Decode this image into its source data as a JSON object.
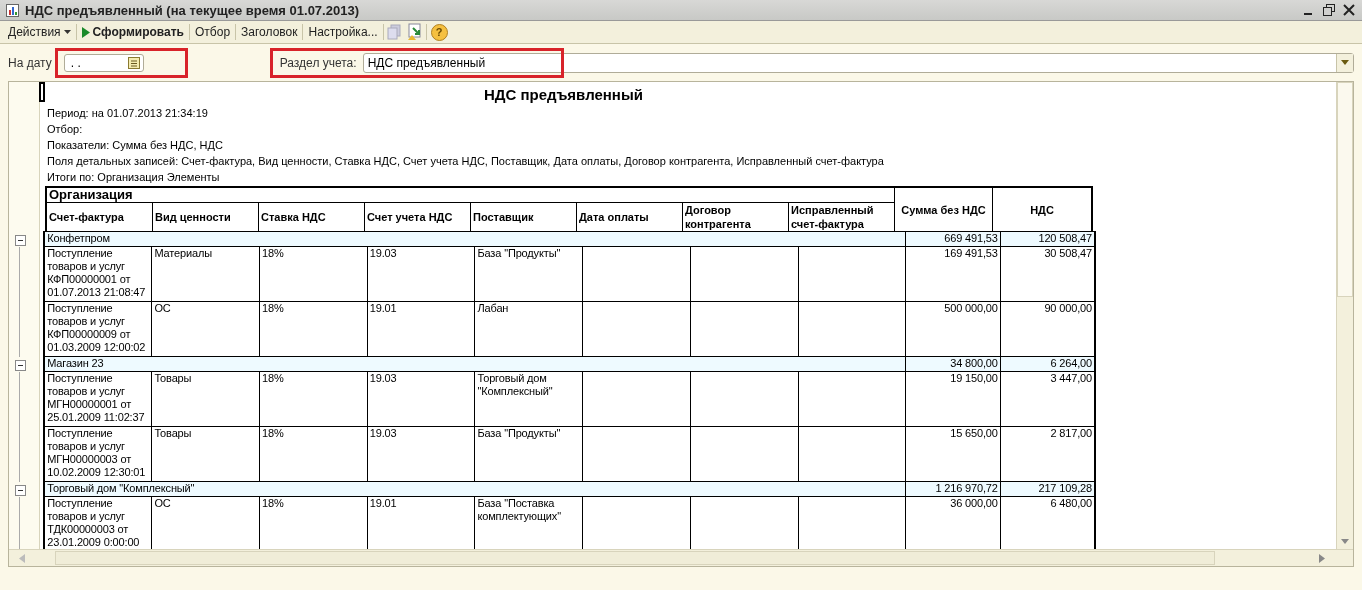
{
  "window": {
    "title": "НДС предъявленный (на текущее время 01.07.2013)"
  },
  "toolbar": [
    {
      "label": "Действия",
      "kind": "dropdown"
    },
    {
      "label": "Сформировать",
      "kind": "run"
    },
    {
      "label": "Отбор",
      "kind": "plain"
    },
    {
      "label": "Заголовок",
      "kind": "plain"
    },
    {
      "label": "Настройка...",
      "kind": "plain"
    },
    {
      "label": "?",
      "kind": "help"
    }
  ],
  "form": {
    "date_label": "На дату",
    "date_value": ". .",
    "section_label": "Раздел учета:",
    "section_value": "НДС предъявленный"
  },
  "report": {
    "title": "НДС предъявленный",
    "info": [
      "Период: на 01.07.2013 21:34:19",
      "Отбор:",
      "Показатели:  Сумма без НДС, НДС",
      "Поля детальных записей:  Счет-фактура, Вид ценности, Ставка НДС, Счет учета НДС, Поставщик, Дата оплаты, Договор контрагента, Исправленный счет-фактура",
      "Итоги по:  Организация Элементы"
    ],
    "group_header": "Организация",
    "columns": [
      "Счет-фактура",
      "Вид ценности",
      "Ставка НДС",
      "Счет учета НДС",
      "Поставщик",
      "Дата оплаты",
      "Договор контрагента",
      "Исправленный счет-фактура"
    ],
    "sum_columns": [
      "Сумма без НДС",
      "НДС"
    ],
    "groups": [
      {
        "name": "Конфетпром",
        "sum": "669 491,53",
        "vat": "120 508,47",
        "expanded": true,
        "rows": [
          {
            "cells": [
              "Поступление товаров и услуг КФП00000001 от 01.07.2013 21:08:47",
              "Материалы",
              "18%",
              "19.03",
              "База \"Продукты\"",
              "",
              "",
              ""
            ],
            "sum": "169 491,53",
            "vat": "30 508,47"
          },
          {
            "cells": [
              "Поступление товаров и услуг КФП00000009 от 01.03.2009 12:00:02",
              "ОС",
              "18%",
              "19.01",
              "Лабан",
              "",
              "",
              ""
            ],
            "sum": "500 000,00",
            "vat": "90 000,00"
          }
        ]
      },
      {
        "name": "Магазин 23",
        "sum": "34 800,00",
        "vat": "6 264,00",
        "expanded": true,
        "rows": [
          {
            "cells": [
              "Поступление товаров и услуг МГН00000001 от 25.01.2009 11:02:37",
              "Товары",
              "18%",
              "19.03",
              "Торговый дом \"Комплексный\"",
              "",
              "",
              ""
            ],
            "sum": "19 150,00",
            "vat": "3 447,00"
          },
          {
            "cells": [
              "Поступление товаров и услуг МГН00000003 от 10.02.2009 12:30:01",
              "Товары",
              "18%",
              "19.03",
              "База \"Продукты\"",
              "",
              "",
              ""
            ],
            "sum": "15 650,00",
            "vat": "2 817,00"
          }
        ]
      },
      {
        "name": "Торговый дом \"Комплексный\"",
        "sum": "1 216 970,72",
        "vat": "217 109,28",
        "expanded": true,
        "rows": [
          {
            "cells": [
              "Поступление товаров и услуг ТДК00000003 от 23.01.2009 0:00:00",
              "ОС",
              "18%",
              "19.01",
              "База \"Поставка комплектующих\"",
              "",
              "",
              ""
            ],
            "sum": "36 000,00",
            "vat": "6 480,00"
          }
        ]
      }
    ]
  }
}
